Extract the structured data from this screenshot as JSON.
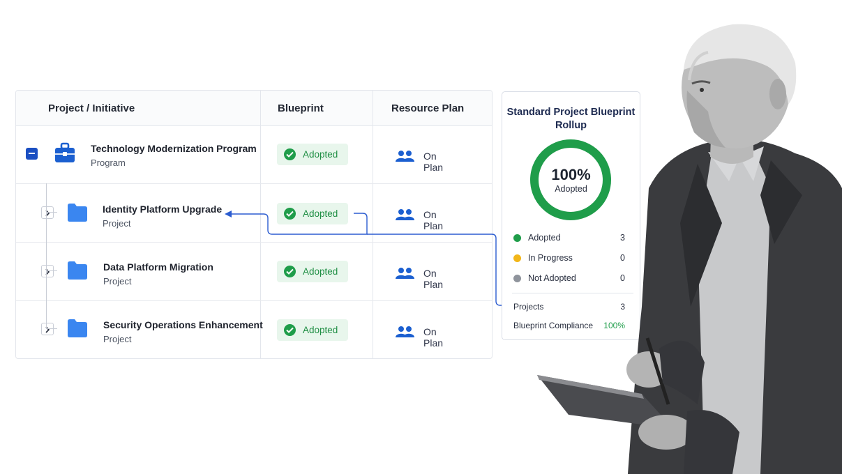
{
  "table": {
    "headers": {
      "project": "Project / Initiative",
      "blueprint": "Blueprint",
      "resource_plan": "Resource Plan"
    },
    "rows": [
      {
        "name": "Technology Modernization Program",
        "type": "Program",
        "blueprint": "Adopted",
        "resource_plan": "On Plan"
      },
      {
        "name": "Identity Platform Upgrade",
        "type": "Project",
        "blueprint": "Adopted",
        "resource_plan": "On Plan"
      },
      {
        "name": "Data Platform Migration",
        "type": "Project",
        "blueprint": "Adopted",
        "resource_plan": "On Plan"
      },
      {
        "name": "Security Operations Enhancement",
        "type": "Project",
        "blueprint": "Adopted",
        "resource_plan": "On Plan"
      }
    ]
  },
  "rollup": {
    "title_line1": "Standard Project Blueprint",
    "title_line2": "Rollup",
    "percent": "100%",
    "percent_label": "Adopted",
    "adopted_fraction": 1.0,
    "legend": [
      {
        "label": "Adopted",
        "count": "3",
        "color": "#1f9d4a"
      },
      {
        "label": "In Progress",
        "count": "0",
        "color": "#f2b619"
      },
      {
        "label": "Not Adopted",
        "count": "0",
        "color": "#8f949c"
      }
    ],
    "projects_label": "Projects",
    "projects_count": "3",
    "compliance_label": "Blueprint Compliance",
    "compliance_value": "100%"
  },
  "colors": {
    "accent": "#1b4fc2",
    "success": "#1f9d4a",
    "folder": "#3a86f0"
  },
  "icons": {
    "program": "briefcase-icon",
    "project": "folder-icon",
    "status": "check-circle-icon",
    "resource": "users-icon"
  }
}
